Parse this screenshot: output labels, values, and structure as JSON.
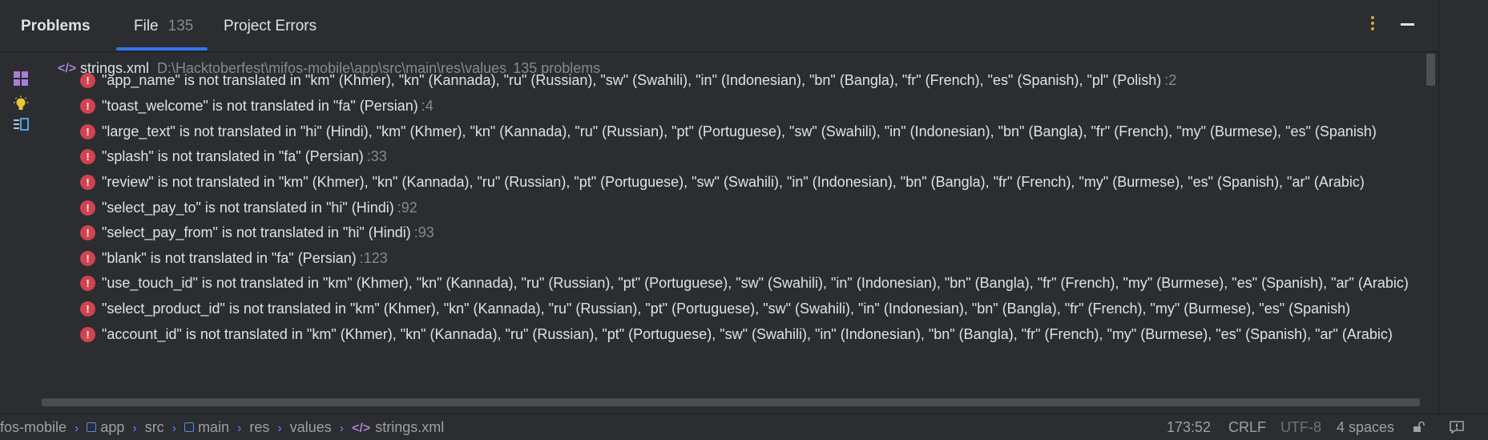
{
  "panel": {
    "title": "Problems",
    "tabs": [
      {
        "label": "File",
        "count": "135"
      },
      {
        "label": "Project Errors"
      }
    ]
  },
  "file": {
    "icon": "</>",
    "name": "strings.xml",
    "path": "D:\\Hacktoberfest\\mifos-mobile\\app\\src\\main\\res\\values",
    "count": "135 problems"
  },
  "problems": [
    {
      "text": "\"app_name\" is not translated in \"km\" (Khmer), \"kn\" (Kannada), \"ru\" (Russian), \"sw\" (Swahili), \"in\" (Indonesian), \"bn\" (Bangla), \"fr\" (French), \"es\" (Spanish), \"pl\" (Polish)",
      "line": ":2"
    },
    {
      "text": "\"toast_welcome\" is not translated in \"fa\" (Persian)",
      "line": ":4"
    },
    {
      "text": "\"large_text\" is not translated in \"hi\" (Hindi), \"km\" (Khmer), \"kn\" (Kannada), \"ru\" (Russian), \"pt\" (Portuguese), \"sw\" (Swahili), \"in\" (Indonesian), \"bn\" (Bangla), \"fr\" (French), \"my\" (Burmese), \"es\" (Spanish)",
      "line": ""
    },
    {
      "text": "\"splash\" is not translated in \"fa\" (Persian)",
      "line": ":33"
    },
    {
      "text": "\"review\" is not translated in \"km\" (Khmer), \"kn\" (Kannada), \"ru\" (Russian), \"pt\" (Portuguese), \"sw\" (Swahili), \"in\" (Indonesian), \"bn\" (Bangla), \"fr\" (French), \"my\" (Burmese), \"es\" (Spanish), \"ar\" (Arabic)",
      "line": ""
    },
    {
      "text": "\"select_pay_to\" is not translated in \"hi\" (Hindi)",
      "line": ":92"
    },
    {
      "text": "\"select_pay_from\" is not translated in \"hi\" (Hindi)",
      "line": ":93"
    },
    {
      "text": "\"blank\" is not translated in \"fa\" (Persian)",
      "line": ":123"
    },
    {
      "text": "\"use_touch_id\" is not translated in \"km\" (Khmer), \"kn\" (Kannada), \"ru\" (Russian), \"pt\" (Portuguese), \"sw\" (Swahili), \"in\" (Indonesian), \"bn\" (Bangla), \"fr\" (French), \"my\" (Burmese), \"es\" (Spanish), \"ar\" (Arabic)",
      "line": ""
    },
    {
      "text": "\"select_product_id\" is not translated in \"km\" (Khmer), \"kn\" (Kannada), \"ru\" (Russian), \"pt\" (Portuguese), \"sw\" (Swahili), \"in\" (Indonesian), \"bn\" (Bangla), \"fr\" (French), \"my\" (Burmese), \"es\" (Spanish)",
      "line": ""
    },
    {
      "text": "\"account_id\" is not translated in \"km\" (Khmer), \"kn\" (Kannada), \"ru\" (Russian), \"pt\" (Portuguese), \"sw\" (Swahili), \"in\" (Indonesian), \"bn\" (Bangla), \"fr\" (French), \"my\" (Burmese), \"es\" (Spanish), \"ar\" (Arabic)",
      "line": ""
    }
  ],
  "breadcrumbs": [
    "fos-mobile",
    "app",
    "src",
    "main",
    "res",
    "values",
    "strings.xml"
  ],
  "status": {
    "position": "173:52",
    "line_ending": "CRLF",
    "encoding": "UTF-8",
    "indent": "4 spaces"
  },
  "colors": {
    "accent": "#3574f0",
    "error": "#d14350",
    "xml_icon": "#a87fd8"
  }
}
